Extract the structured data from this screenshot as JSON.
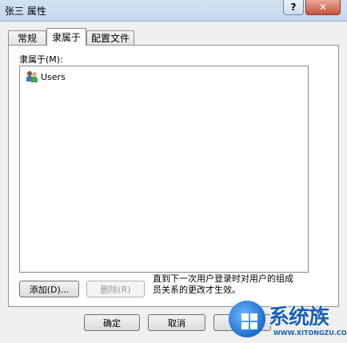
{
  "window": {
    "title": "张三 属性",
    "help": "?",
    "close": "✕"
  },
  "tabs": [
    {
      "label": "常规",
      "active": false
    },
    {
      "label": "隶属于",
      "active": true
    },
    {
      "label": "配置文件",
      "active": false
    }
  ],
  "member_of": {
    "label": "隶属于(M):",
    "items": [
      {
        "name": "Users",
        "icon": "users-group-icon"
      }
    ]
  },
  "buttons": {
    "add": "添加(D)...",
    "remove": "删除(R)",
    "ok": "确定",
    "cancel": "取消",
    "apply": "应"
  },
  "note": "直到下一次用户登录时对用户的组成员关系的更改才生效。",
  "watermark": {
    "text": "系统族",
    "url": "WWW.XITONGZU.COM"
  }
}
